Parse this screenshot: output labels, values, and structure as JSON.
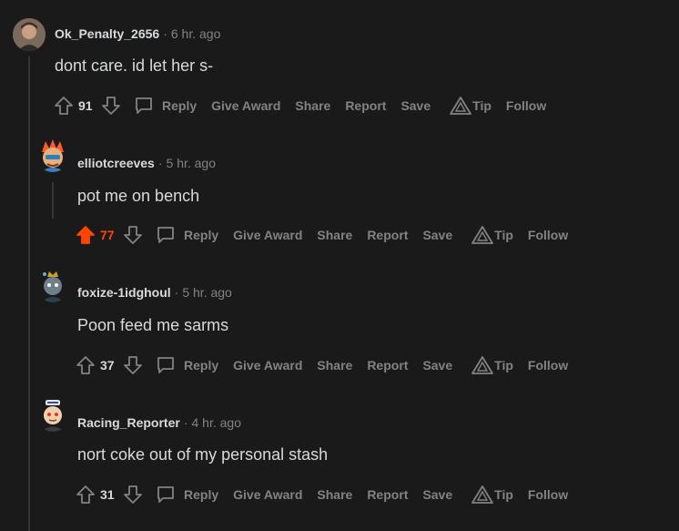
{
  "comments": [
    {
      "username": "Ok_Penalty_2656",
      "time": "6 hr. ago",
      "body": "dont care. id let her s-",
      "score": "91",
      "upvoted": false
    },
    {
      "username": "elliotcreeves",
      "time": "5 hr. ago",
      "body": "pot me on bench",
      "score": "77",
      "upvoted": true
    },
    {
      "username": "foxize-1idghoul",
      "time": "5 hr. ago",
      "body": "Poon feed me sarms",
      "score": "37",
      "upvoted": false
    },
    {
      "username": "Racing_Reporter",
      "time": "4 hr. ago",
      "body": "nort coke out of my personal stash",
      "score": "31",
      "upvoted": false
    }
  ],
  "actions": {
    "reply": "Reply",
    "give_award": "Give Award",
    "share": "Share",
    "report": "Report",
    "save": "Save",
    "tip": "Tip",
    "follow": "Follow"
  },
  "colors": {
    "background": "#1a1a1b",
    "text": "#d7dadc",
    "muted": "#818384",
    "upvote_active": "#ff4500",
    "thread_line": "#343536"
  }
}
